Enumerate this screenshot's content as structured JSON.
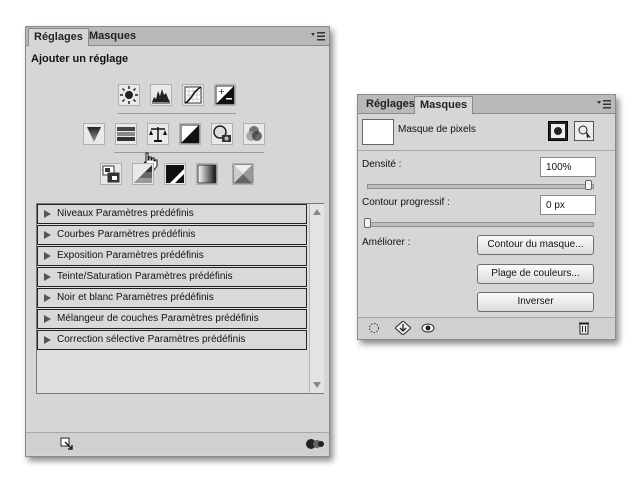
{
  "left_panel": {
    "tabs": [
      {
        "label": "Réglages"
      },
      {
        "label": "Masques"
      }
    ],
    "section_title": "Ajouter un réglage",
    "icons_row1": [
      "brightness-contrast-icon",
      "levels-icon",
      "curves-icon",
      "exposure-icon"
    ],
    "icons_row2": [
      "vibrance-icon",
      "hue-saturation-icon",
      "color-balance-icon",
      "black-white-icon",
      "photo-filter-icon",
      "channel-mixer-icon"
    ],
    "icons_row3": [
      "invert-icon",
      "posterize-icon",
      "threshold-icon",
      "gradient-map-icon",
      "selective-color-icon"
    ],
    "presets": [
      {
        "label": "Niveaux Paramètres prédéfinis"
      },
      {
        "label": "Courbes Paramètres prédéfinis"
      },
      {
        "label": "Exposition Paramètres prédéfinis"
      },
      {
        "label": "Teinte/Saturation Paramètres prédéfinis"
      },
      {
        "label": "Noir et blanc Paramètres prédéfinis"
      },
      {
        "label": "Mélangeur de couches Paramètres prédéfinis"
      },
      {
        "label": "Correction sélective Paramètres prédéfinis"
      }
    ]
  },
  "right_panel": {
    "tabs": [
      {
        "label": "Réglages"
      },
      {
        "label": "Masques"
      }
    ],
    "mask_label": "Masque de pixels",
    "density": {
      "label": "Densité :",
      "value": "100%",
      "slider_fraction": 1.0
    },
    "feather": {
      "label": "Contour progressif :",
      "value": "0 px",
      "slider_fraction": 0.0
    },
    "refine": {
      "label": "Améliorer :"
    },
    "buttons": {
      "mask_edge": "Contour du masque...",
      "color_range": "Plage de couleurs...",
      "invert": "Inverser"
    }
  }
}
